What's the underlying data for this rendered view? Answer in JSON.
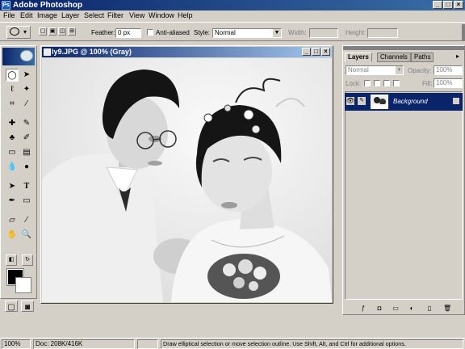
{
  "app": {
    "title": "Adobe Photoshop"
  },
  "menu": [
    "File",
    "Edit",
    "Image",
    "Layer",
    "Select",
    "Filter",
    "View",
    "Window",
    "Help"
  ],
  "options": {
    "feather_label": "Feather:",
    "feather_value": "0 px",
    "antialias_label": "Anti-aliased",
    "style_label": "Style:",
    "style_value": "Normal",
    "width_label": "Width:",
    "height_label": "Height:"
  },
  "document": {
    "title": "ly9.JPG @ 100% (Gray)"
  },
  "layers_palette": {
    "tabs": [
      "Layers",
      "Channels",
      "Paths"
    ],
    "blend_mode": "Normal",
    "opacity_label": "Opacity:",
    "opacity_value": "100%",
    "lock_label": "Lock:",
    "fill_label": "Fill:",
    "fill_value": "100%",
    "layers": [
      {
        "name": "Background",
        "selected": true,
        "visible": true,
        "locked": true
      }
    ]
  },
  "status": {
    "zoom": "100%",
    "doc_info": "Doc: 208K/416K",
    "hint": "Draw elliptical selection or move selection outline. Use Shift, Alt, and Ctrl for additional options."
  },
  "colors": {
    "title_bar": "#0a246a",
    "selected_layer": "#0a246a",
    "foreground": "#000000",
    "background": "#ffffff"
  }
}
